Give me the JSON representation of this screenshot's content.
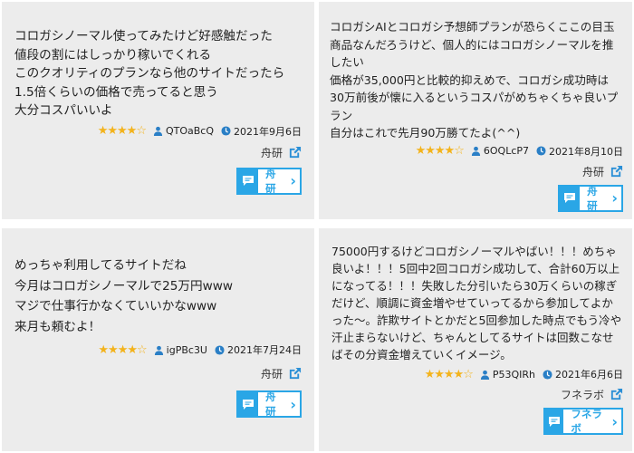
{
  "reviews": [
    {
      "text": "コロガシノーマル使ってみたけど好感触だった\n値段の割にはしっかり稼いでくれる\nこのクオリティのプランなら他のサイトだったら1.5倍くらいの価格で売ってると思う\n大分コスパいいよ",
      "rating": 4,
      "user": "QTOaBcQ",
      "date": "2021年9月6日",
      "source": "舟研",
      "button_label": "舟研"
    },
    {
      "text": "コロガシAIとコロガシ予想師プランが恐らくここの目玉商品なんだろうけど、個人的にはコロガシノーマルを推したい\n価格が35,000円と比較的抑えめで、コロガシ成功時は30万前後が懐に入るというコスパがめちゃくちゃ良いプラン\n自分はこれで先月90万勝てたよ(^^)",
      "rating": 4,
      "user": "6OQLcP7",
      "date": "2021年8月10日",
      "source": "舟研",
      "button_label": "舟研"
    },
    {
      "text": "めっちゃ利用してるサイトだね\n今月はコロガシノーマルで25万円www\nマジで仕事行かなくていいかなwww\n来月も頼むよ！",
      "rating": 4,
      "user": "igPBc3U",
      "date": "2021年7月24日",
      "source": "舟研",
      "button_label": "舟研"
    },
    {
      "text": "75000円するけどコロガシノーマルやばい！！！めちゃ良いよ！！！5回中2回コロガシ成功して、合計60万以上になってる！！！失敗した分引いたら30万くらいの稼ぎだけど、順調に資金増やせていってるから参加してよかった〜。詐欺サイトとかだと5回参加した時点でもう冷や汗止まらないけど、ちゃんとしてるサイトは回数こなせばその分資金増えていくイメージ。",
      "rating": 4,
      "user": "P53QIRh",
      "date": "2021年6月6日",
      "source": "フネラボ",
      "button_label": "フネラボ"
    }
  ],
  "colors": {
    "accent": "#2aa6e6",
    "star": "#f3b31c",
    "card_bg": "#ececec"
  }
}
